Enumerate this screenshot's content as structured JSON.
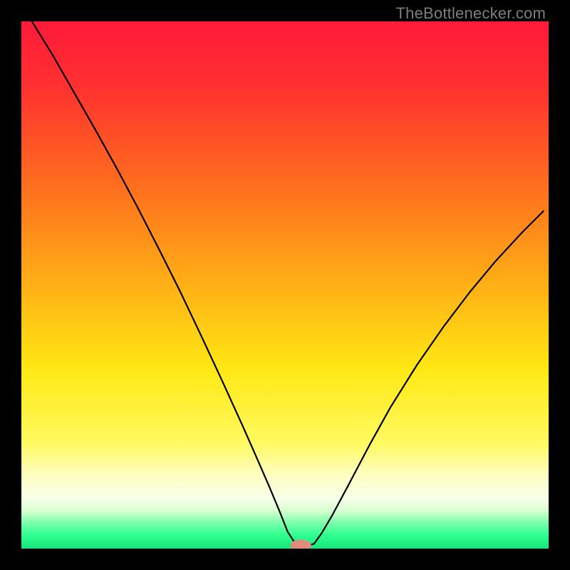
{
  "watermark": "TheBottlenecker.com",
  "chart_data": {
    "type": "line",
    "title": "",
    "xlabel": "",
    "ylabel": "",
    "xlim": [
      0,
      100
    ],
    "ylim": [
      0,
      100
    ],
    "background_gradient": {
      "stops": [
        {
          "offset": 0.0,
          "color": "#ff1a3a"
        },
        {
          "offset": 0.12,
          "color": "#ff3030"
        },
        {
          "offset": 0.3,
          "color": "#ff6a1f"
        },
        {
          "offset": 0.5,
          "color": "#ffb015"
        },
        {
          "offset": 0.66,
          "color": "#ffe814"
        },
        {
          "offset": 0.8,
          "color": "#fffa60"
        },
        {
          "offset": 0.86,
          "color": "#fdfec0"
        },
        {
          "offset": 0.905,
          "color": "#f7ffe8"
        },
        {
          "offset": 0.928,
          "color": "#d8ffd0"
        },
        {
          "offset": 0.95,
          "color": "#7fffad"
        },
        {
          "offset": 0.975,
          "color": "#2fff8f"
        },
        {
          "offset": 1.0,
          "color": "#16e57a"
        }
      ]
    },
    "series": [
      {
        "name": "bottleneck-curve",
        "stroke": "#000000",
        "stroke_width": 2.2,
        "x": [
          2,
          6,
          10,
          14,
          18,
          22,
          26,
          30,
          34,
          38,
          42,
          45,
          47,
          49,
          50.5,
          52,
          53.5,
          55.5,
          57,
          59,
          62,
          66,
          70,
          75,
          80,
          85,
          90,
          95,
          99
        ],
        "y": [
          100,
          93.5,
          86.5,
          79.5,
          72.3,
          64.8,
          57.0,
          49.0,
          40.6,
          32.0,
          23.2,
          16.4,
          11.8,
          7.0,
          3.2,
          0.9,
          0.4,
          0.9,
          3.0,
          6.4,
          12.0,
          19.6,
          26.8,
          34.8,
          42.0,
          48.6,
          54.6,
          60.0,
          64.0
        ]
      }
    ],
    "marker": {
      "x": 53.0,
      "y": 0.6,
      "rx": 2.0,
      "ry": 1.1,
      "color": "#e08b7c"
    }
  }
}
